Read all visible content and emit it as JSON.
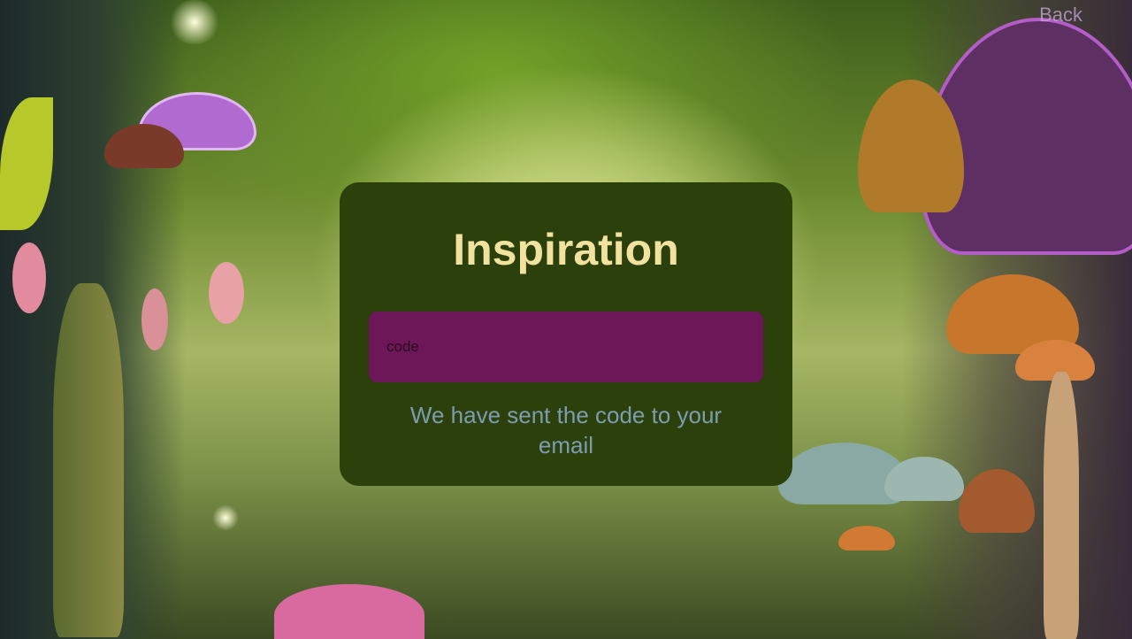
{
  "app": {
    "back_label": "Back"
  },
  "card": {
    "title": "Inspiration",
    "code_placeholder": "code",
    "code_value": "",
    "message": "We have sent the code to your email"
  },
  "colors": {
    "card_background": "#2b400b",
    "title_color": "#f1e2a0",
    "input_background": "#6e1758",
    "message_color": "#7e9cb0",
    "back_color": "#c6a7d8"
  }
}
